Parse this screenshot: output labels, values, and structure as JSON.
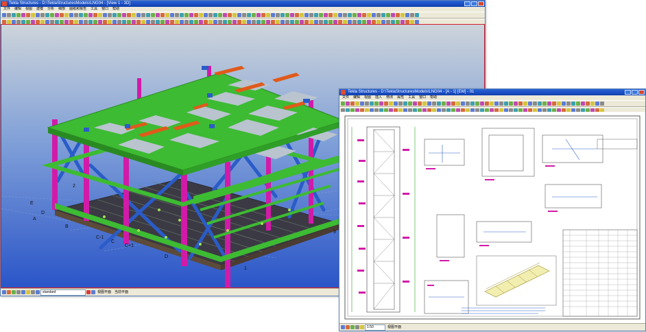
{
  "model_window": {
    "title": "Tekla Structures - D:\\TeklaStructuresModels\\LNG04 - [View 1 - 3D]",
    "menu": [
      "文件",
      "编辑",
      "视图",
      "建模",
      "分析",
      "细部",
      "图纸和报告",
      "工具",
      "窗口",
      "帮助"
    ],
    "status": {
      "selection_filter": "standard",
      "plane_label": "视图平面",
      "view_label": "当前平面"
    },
    "grid_labels": {
      "letters": [
        "E",
        "D",
        "A",
        "B",
        "C-1",
        "C",
        "C+1",
        "D"
      ],
      "numbers": [
        "2",
        "3",
        "1"
      ]
    },
    "colors": {
      "beam": "#3dbb32",
      "column": "#d21aa8",
      "brace": "#2a5cc8",
      "secondary": "#e05a1a",
      "background_top": "#c2ccd6",
      "background_bottom": "#2a55c8"
    }
  },
  "drawing_window": {
    "title": "Tekla Structures - D:\\TeklaStructuresModels\\LNG04 - [A - 1] [EM] - 01",
    "menu": [
      "文件",
      "编辑",
      "视图",
      "插入",
      "修改",
      "属性",
      "工具",
      "窗口",
      "帮助"
    ],
    "status": {
      "scale": "1:50",
      "plane_label": "视图平面"
    }
  }
}
